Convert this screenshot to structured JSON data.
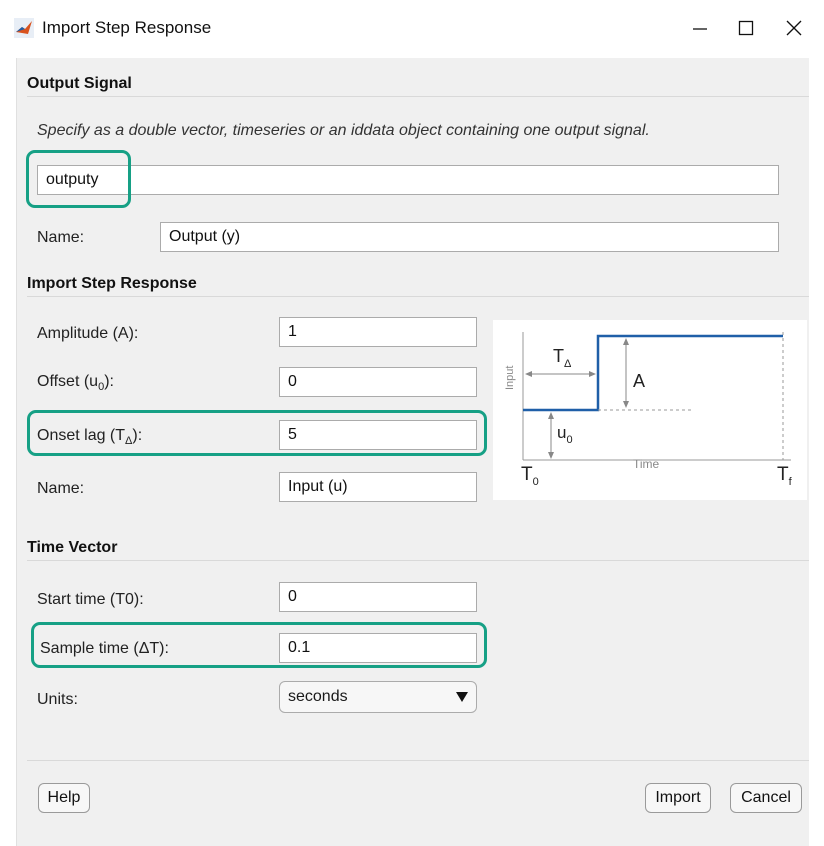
{
  "window": {
    "title": "Import Step Response"
  },
  "output_signal": {
    "header": "Output Signal",
    "hint": "Specify as a double vector, timeseries or an iddata object containing one output signal.",
    "value": "outputy",
    "name_label": "Name:",
    "name_value": "Output (y)"
  },
  "step_response": {
    "header": "Import Step Response",
    "amplitude_label": "Amplitude (A):",
    "amplitude_value": "1",
    "offset_label_main": "Offset (u",
    "offset_label_sub": "0",
    "offset_label_end": "):",
    "offset_value": "0",
    "onset_label_main": "Onset lag (T",
    "onset_label_sub": "Δ",
    "onset_label_end": "):",
    "onset_value": "5",
    "name_label": "Name:",
    "name_value": "Input (u)"
  },
  "diagram": {
    "t_delta_main": "T",
    "t_delta_sub": "Δ",
    "a_label": "A",
    "u0_main": "u",
    "u0_sub": "0",
    "input_axis": "Input",
    "time_axis": "Time",
    "t0_main": "T",
    "t0_sub": "0",
    "tf_main": "T",
    "tf_sub": "f"
  },
  "time_vector": {
    "header": "Time Vector",
    "start_label": "Start time (T0):",
    "start_value": "0",
    "sample_label": "Sample time (ΔT):",
    "sample_value": "0.1",
    "units_label": "Units:",
    "units_value": "seconds"
  },
  "buttons": {
    "help": "Help",
    "import": "Import",
    "cancel": "Cancel"
  },
  "colors": {
    "highlight": "#16a085",
    "step_line": "#1f5fa8"
  }
}
